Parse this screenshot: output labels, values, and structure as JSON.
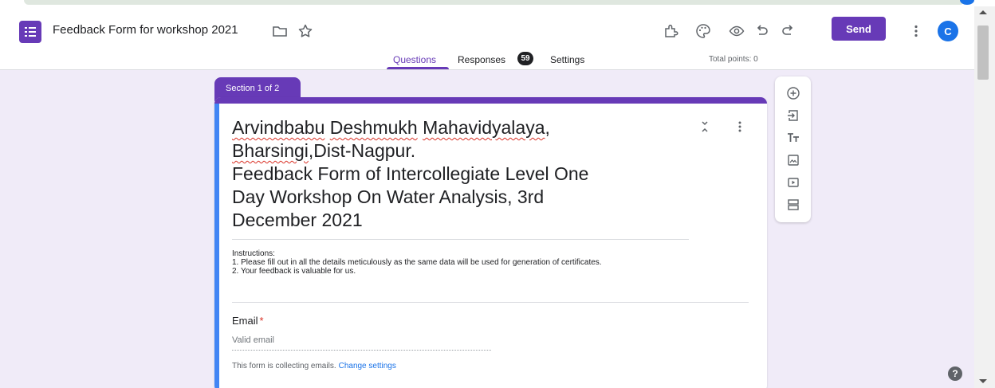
{
  "header": {
    "title": "Feedback Form for workshop 2021",
    "icons": [
      "folder-icon",
      "star-icon",
      "addon-icon",
      "palette-icon",
      "preview-icon",
      "undo-icon",
      "redo-icon",
      "more-vert-icon"
    ],
    "send_label": "Send",
    "avatar_letter": "C"
  },
  "tabs": {
    "questions": "Questions",
    "responses": "Responses",
    "responses_count": "59",
    "settings": "Settings",
    "total_points": "Total points: 0"
  },
  "section": {
    "label": "Section 1 of 2"
  },
  "form": {
    "title_lines": [
      [
        "Arvindbabu",
        " ",
        "Deshmukh",
        " ",
        "Mahavidyalaya",
        ","
      ],
      [
        "Bharsingi",
        ",Dist-Nagpur."
      ],
      "Feedback Form of Intercollegiate Level One",
      "Day Workshop On Water Analysis, 3rd",
      "December 2021"
    ],
    "description": [
      "Instructions:",
      "1. Please fill out in all the details meticulously as the same data will be used for generation of certificates.",
      "2. Your feedback is valuable for us."
    ],
    "email_label": "Email",
    "email_required_mark": "*",
    "email_placeholder": "Valid email",
    "collect_note": "This form is collecting emails.",
    "change_settings": "Change settings"
  },
  "side_toolbar": [
    "add-question-icon",
    "import-questions-icon",
    "add-title-icon",
    "add-image-icon",
    "add-video-icon",
    "add-section-icon"
  ],
  "help_label": "?",
  "colors": {
    "accent": "#673ab7",
    "background": "#f0ebf8",
    "link": "#1a73e8",
    "required": "#d93025",
    "card_highlight": "#4285f4"
  }
}
